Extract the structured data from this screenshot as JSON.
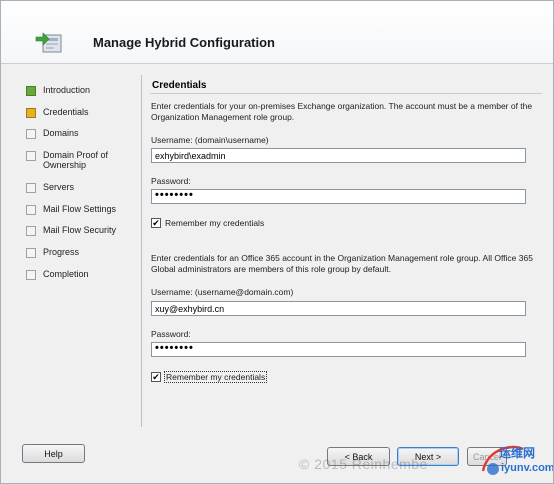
{
  "window": {
    "title": "Manage Hybrid Configuration"
  },
  "nav": {
    "items": [
      {
        "label": "Introduction",
        "state": "done"
      },
      {
        "label": "Credentials",
        "state": "current"
      },
      {
        "label": "Domains",
        "state": "pending"
      },
      {
        "label": "Domain Proof of Ownership",
        "state": "pending"
      },
      {
        "label": "Servers",
        "state": "pending"
      },
      {
        "label": "Mail Flow Settings",
        "state": "pending"
      },
      {
        "label": "Mail Flow Security",
        "state": "pending"
      },
      {
        "label": "Progress",
        "state": "pending"
      },
      {
        "label": "Completion",
        "state": "pending"
      }
    ]
  },
  "main": {
    "section_title": "Credentials",
    "onprem": {
      "description": "Enter credentials for your on-premises Exchange organization. The account must be a member of the Organization Management role group.",
      "username_label": "Username: (domain\\username)",
      "username_value": "exhybird\\exadmin",
      "password_label": "Password:",
      "password_value": "••••••••",
      "remember_label": "Remember my credentials",
      "remember_checked": true
    },
    "office365": {
      "description": "Enter credentials for an Office 365 account in the Organization Management role group. All Office 365 Global administrators are members of this role group by default.",
      "username_label": "Username: (username@domain.com)",
      "username_value": "xuy@exhybird.cn",
      "password_label": "Password:",
      "password_value": "••••••••",
      "remember_label": "Remember my credentials",
      "remember_checked": true
    }
  },
  "footer": {
    "help_label": "Help",
    "back_label": "< Back",
    "next_label": "Next >",
    "cancel_label": "Cancel"
  },
  "overlay": {
    "watermark": "© 2015 Reinhembe",
    "logo_text": "运维网",
    "logo_sub": "iyunv.com"
  },
  "colors": {
    "done": "#6aa83a",
    "current": "#e2b229",
    "default_button": "#3b7fc4"
  }
}
